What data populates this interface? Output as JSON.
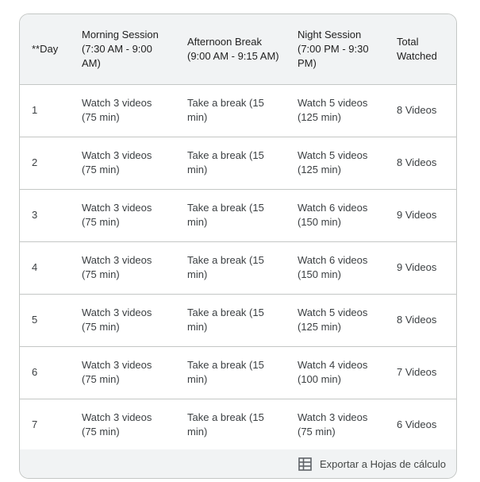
{
  "table": {
    "headers": [
      "**Day",
      "Morning Session (7:30 AM - 9:00 AM)",
      "Afternoon Break (9:00 AM - 9:15 AM)",
      "Night Session (7:00 PM - 9:30 PM)",
      "Total Watched"
    ],
    "rows": [
      [
        "1",
        "Watch 3 videos (75 min)",
        "Take a break (15 min)",
        "Watch 5 videos (125 min)",
        "8 Videos"
      ],
      [
        "2",
        "Watch 3 videos (75 min)",
        "Take a break (15 min)",
        "Watch 5 videos (125 min)",
        "8 Videos"
      ],
      [
        "3",
        "Watch 3 videos (75 min)",
        "Take a break (15 min)",
        "Watch 6 videos (150 min)",
        "9 Videos"
      ],
      [
        "4",
        "Watch 3 videos (75 min)",
        "Take a break (15 min)",
        "Watch 6 videos (150 min)",
        "9 Videos"
      ],
      [
        "5",
        "Watch 3 videos (75 min)",
        "Take a break (15 min)",
        "Watch 5 videos (125 min)",
        "8 Videos"
      ],
      [
        "6",
        "Watch 3 videos (75 min)",
        "Take a break (15 min)",
        "Watch 4 videos (100 min)",
        "7 Videos"
      ],
      [
        "7",
        "Watch 3 videos (75 min)",
        "Take a break (15 min)",
        "Watch 3 videos (75 min)",
        "6 Videos"
      ]
    ]
  },
  "footer": {
    "export_label": "Exportar a Hojas de cálculo",
    "export_icon": "table-icon"
  },
  "colors": {
    "header_bg": "#f1f3f4",
    "border": "#c4c7c5"
  }
}
